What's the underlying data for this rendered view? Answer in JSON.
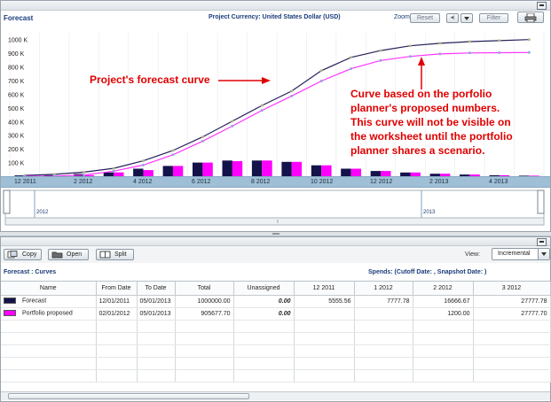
{
  "forecast_panel": {
    "title": "Forecast",
    "currency_label": "Project Currency: United States Dollar (USD)",
    "zoom_label": "Zoom",
    "reset_button": "Reset",
    "prev_button": "◀|",
    "filter_button": "Filter",
    "print_icon": "printer-icon"
  },
  "annotations": {
    "forecast_curve": "Project's forecast curve",
    "proposed_curve": [
      "Curve based on the porfolio",
      "planner's proposed numbers.",
      "This curve will not be visible on",
      "the worksheet until the portfolio",
      "planner shares a scenario."
    ]
  },
  "overview": {
    "label_a": "2012",
    "label_b": "2013"
  },
  "chart_data": {
    "type": "bar",
    "ylim": [
      0,
      1050000
    ],
    "yticks": [
      "100 K",
      "200 K",
      "300 K",
      "400 K",
      "500 K",
      "600 K",
      "700 K",
      "800 K",
      "900 K",
      "1000 K"
    ],
    "ytick_values": [
      100000,
      200000,
      300000,
      400000,
      500000,
      600000,
      700000,
      800000,
      900000,
      1000000
    ],
    "categories": [
      "12 2011",
      "1 2012",
      "2 2012",
      "3 2012",
      "4 2012",
      "5 2012",
      "6 2012",
      "7 2012",
      "8 2012",
      "9 2012",
      "10 2012",
      "11 2012",
      "12 2012",
      "1 2013",
      "2 2013",
      "3 2013",
      "4 2013",
      "5 2013"
    ],
    "x_tick_labels": [
      "12 2011",
      "2 2012",
      "4 2012",
      "6 2012",
      "8 2012",
      "10 2012",
      "12 2012",
      "2 2013",
      "4 2013"
    ],
    "series": [
      {
        "name": "Forecast",
        "kind": "bar",
        "color": "#14124a",
        "values": [
          5556,
          7778,
          16667,
          27778,
          55000,
          75000,
          100000,
          115000,
          115000,
          105000,
          80000,
          55000,
          38000,
          27000,
          18000,
          12000,
          7000,
          4000
        ]
      },
      {
        "name": "Portfolio proposed",
        "kind": "bar",
        "color": "#ff00ff",
        "values": [
          0,
          1200,
          8000,
          27778,
          45000,
          75000,
          100000,
          110000,
          115000,
          105000,
          80000,
          55000,
          38000,
          27000,
          18000,
          12000,
          7000,
          4000
        ]
      },
      {
        "name": "Forecast",
        "kind": "line",
        "color": "#23205a",
        "values": [
          5556,
          13333,
          30000,
          57778,
          112778,
          187778,
          287778,
          402778,
          517778,
          622778,
          772778,
          870000,
          920000,
          955000,
          973000,
          985000,
          992000,
          1000000
        ]
      },
      {
        "name": "Portfolio proposed",
        "kind": "line",
        "color": "#ff33ff",
        "values": [
          0,
          1200,
          9200,
          36978,
          81978,
          156978,
          256978,
          366978,
          481978,
          586978,
          696978,
          786978,
          846978,
          876978,
          895000,
          902000,
          904000,
          905678
        ]
      }
    ]
  },
  "curves_panel": {
    "copy_button": "Copy",
    "open_button": "Open",
    "split_button": "Split",
    "view_label": "View:",
    "view_value": "Incremental",
    "title": "Forecast : Curves",
    "spends_label": "Spends: (Cutoff Date: , Snapshot Date: )",
    "columns": [
      "Name",
      "From Date",
      "To Date",
      "Total",
      "Unassigned",
      "12 2011",
      "1 2012",
      "2 2012",
      "3 2012"
    ],
    "rows": [
      {
        "color": "#14124a",
        "name": "Forecast",
        "from": "12/01/2011",
        "to": "05/01/2013",
        "total": "1000000.00",
        "unassigned": "0.00",
        "m1": "5555.56",
        "m2": "7777.78",
        "m3": "16666.67",
        "m4": "27777.78"
      },
      {
        "color": "#ff00ff",
        "name": "Portfolio proposed",
        "from": "02/01/2012",
        "to": "05/01/2013",
        "total": "905677.70",
        "unassigned": "0.00",
        "m1": "",
        "m2": "",
        "m3": "1200.00",
        "m4": "27777.70"
      }
    ]
  }
}
